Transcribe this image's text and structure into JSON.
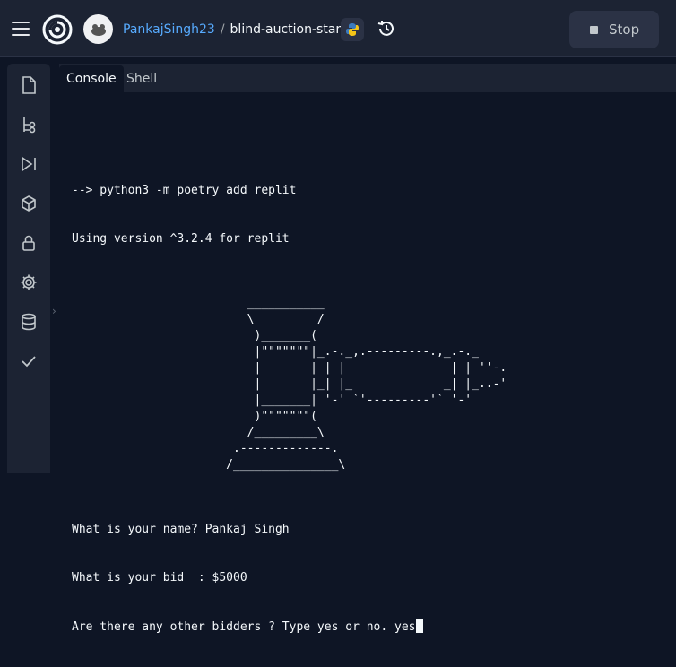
{
  "header": {
    "username": "PankajSingh23",
    "separator": "/",
    "repl_name": "blind-auction-start",
    "stop_label": "Stop"
  },
  "sidebar": {
    "items": [
      {
        "icon": "file-icon"
      },
      {
        "icon": "git-branch-icon"
      },
      {
        "icon": "debugger-icon"
      },
      {
        "icon": "packages-icon"
      },
      {
        "icon": "lock-icon"
      },
      {
        "icon": "gear-icon"
      },
      {
        "icon": "database-icon"
      },
      {
        "icon": "checkmark-icon"
      }
    ]
  },
  "tabs": [
    {
      "label": "Console",
      "active": true
    },
    {
      "label": "Shell",
      "active": false
    }
  ],
  "console": {
    "command": "--> python3 -m poetry add replit",
    "version_line": "Using version ^3.2.4 for replit",
    "ascii_art": "                         ___________\n                         \\         /\n                          )_______(\n                          |\"\"\"\"\"\"\"|_.-._,.---------.,_.-._\n                          |       | | |               | | ''-.\n                          |       |_| |_             _| |_..-'\n                          |_______| '-' `'---------'` '-'\n                          )\"\"\"\"\"\"\"(\n                         /_________\\\n                       .-------------.\n                      /_______________\\",
    "name_prompt": "What is your name? Pankaj Singh",
    "bid_prompt": "What is your bid  : $5000",
    "others_prompt": "Are there any other bidders ? Type yes or no. yes"
  },
  "colors": {
    "background": "#0e1525",
    "panel": "#1c2333",
    "accent_link": "#57abff",
    "text": "#f5f9fc"
  }
}
